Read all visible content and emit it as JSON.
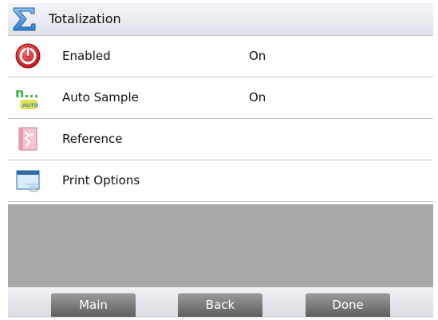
{
  "header": {
    "icon": "sigma-icon",
    "title": "Totalization"
  },
  "menu": {
    "items": [
      {
        "icon": "power-icon",
        "label": "Enabled",
        "value": "On"
      },
      {
        "icon": "auto-sample-icon",
        "label": "Auto Sample",
        "value": "On",
        "icon_text": "n...",
        "icon_subtext": "AUTO"
      },
      {
        "icon": "reference-book-icon",
        "label": "Reference",
        "value": ""
      },
      {
        "icon": "print-options-icon",
        "label": "Print Options",
        "value": ""
      }
    ]
  },
  "footer": {
    "main_label": "Main",
    "back_label": "Back",
    "done_label": "Done"
  },
  "colors": {
    "header_bg": "#e6e8ee",
    "empty_area": "#a9a9a9",
    "button": "#7a7a7a",
    "power_red": "#d8232a",
    "auto_green": "#3cb43c"
  }
}
